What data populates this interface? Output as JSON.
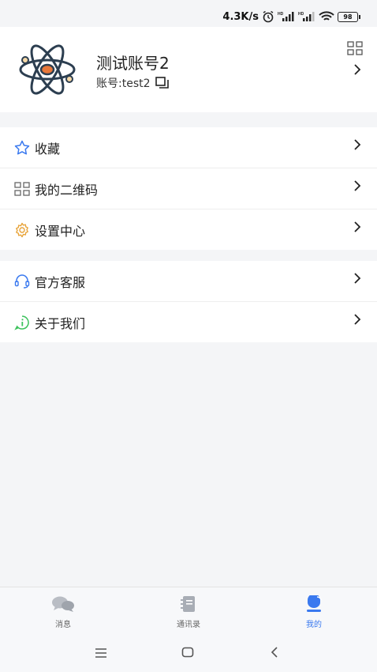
{
  "status": {
    "speed": "4.3K/s",
    "battery": "98"
  },
  "profile": {
    "name": "测试账号2",
    "account_label": "账号:test2"
  },
  "menu_group1": [
    {
      "label": "收藏",
      "icon": "star-icon"
    },
    {
      "label": "我的二维码",
      "icon": "qr-code-icon"
    },
    {
      "label": "设置中心",
      "icon": "gear-icon"
    }
  ],
  "menu_group2": [
    {
      "label": "官方客服",
      "icon": "headset-icon"
    },
    {
      "label": "关于我们",
      "icon": "info-icon"
    }
  ],
  "bottom_nav": [
    {
      "label": "消息",
      "icon": "chat-icon"
    },
    {
      "label": "通讯录",
      "icon": "contacts-icon"
    },
    {
      "label": "我的",
      "icon": "person-icon",
      "active": true
    }
  ],
  "colors": {
    "accent": "#3a79ef",
    "gear": "#e8a43a",
    "info": "#3cc25c",
    "star": "#3a79ef"
  }
}
